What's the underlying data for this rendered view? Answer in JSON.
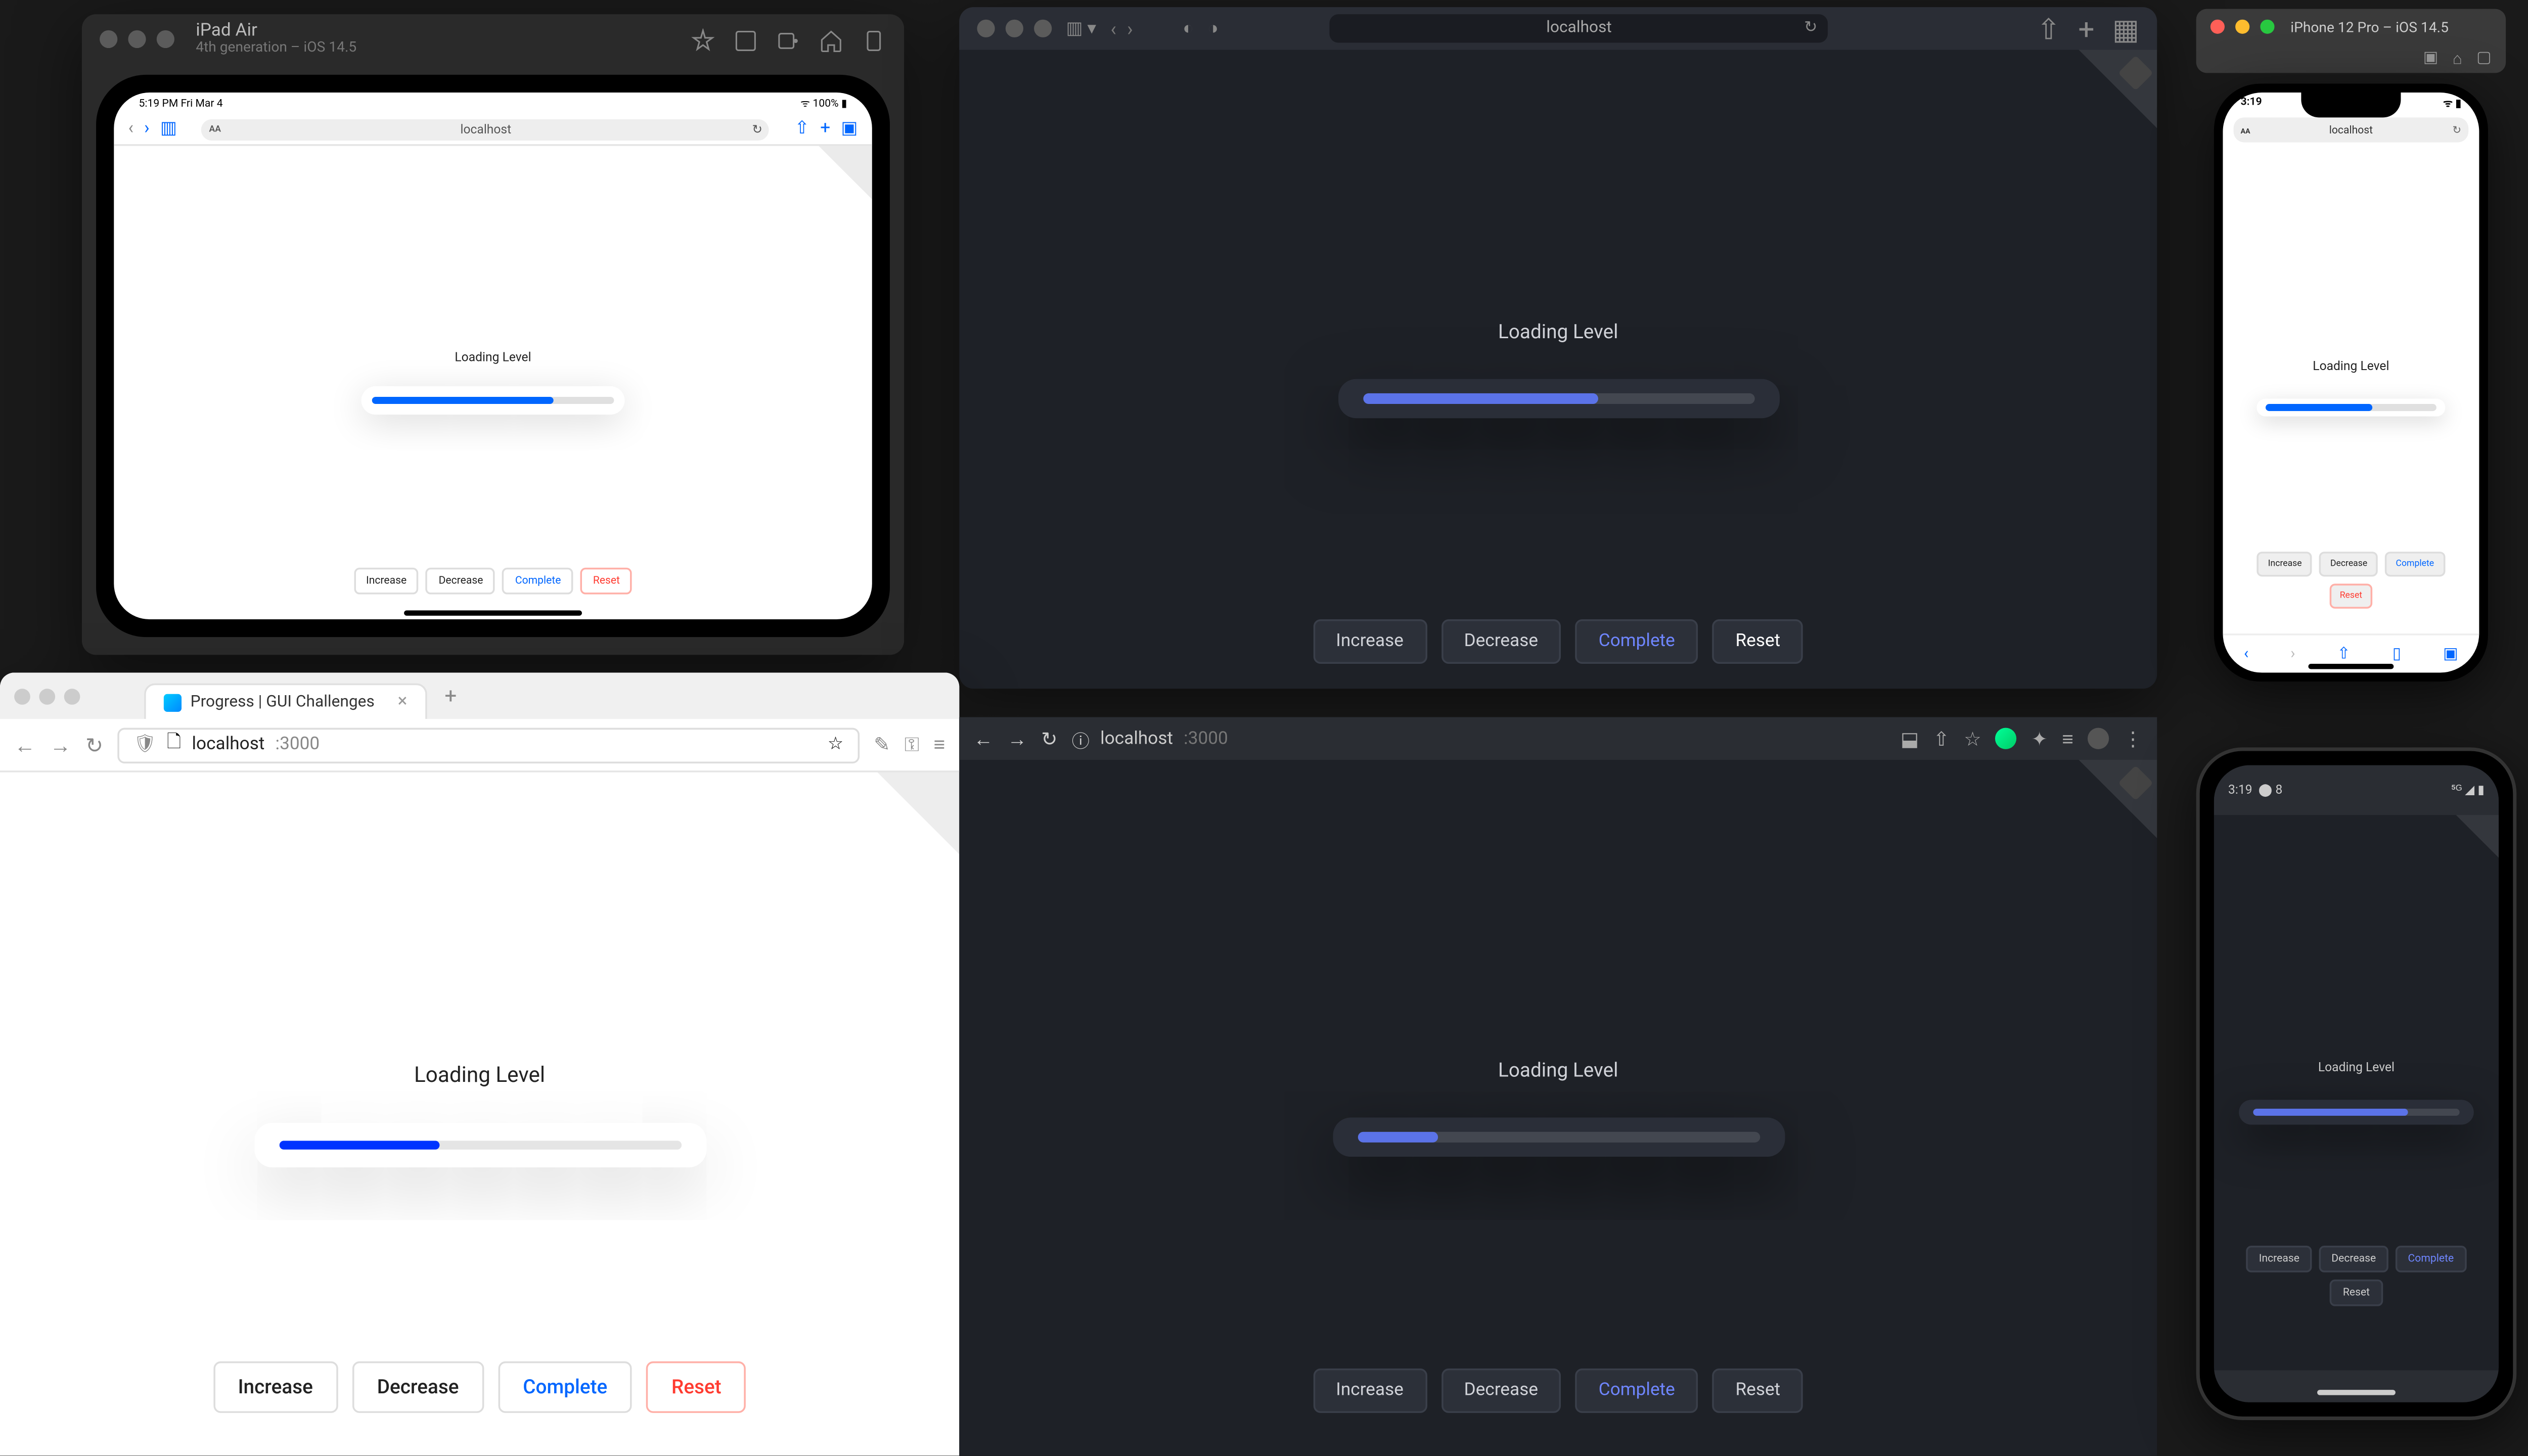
{
  "app": {
    "heading": "Loading Level",
    "buttons": {
      "increase": "Increase",
      "decrease": "Decrease",
      "complete": "Complete",
      "reset": "Reset"
    }
  },
  "ipad": {
    "title": "iPad Air",
    "subtitle": "4th generation – iOS 14.5",
    "status_time": "5:19 PM  Fri Mar 4",
    "status_right": "ᯤ 100% ▮",
    "url": "localhost",
    "progress_pct": 75
  },
  "safari": {
    "url": "localhost",
    "progress_pct": 60
  },
  "iphone": {
    "title": "iPhone 12 Pro – iOS 14.5",
    "status_time": "3:19",
    "url": "localhost",
    "progress_pct": 62
  },
  "firefox": {
    "tab_title": "Progress | GUI Challenges",
    "url_host": "localhost",
    "url_port": ":3000",
    "progress_pct": 40
  },
  "chrome": {
    "url_host": "localhost",
    "url_port": ":3000",
    "progress_pct": 20
  },
  "android": {
    "status_time": "3:19",
    "progress_pct": 75
  }
}
